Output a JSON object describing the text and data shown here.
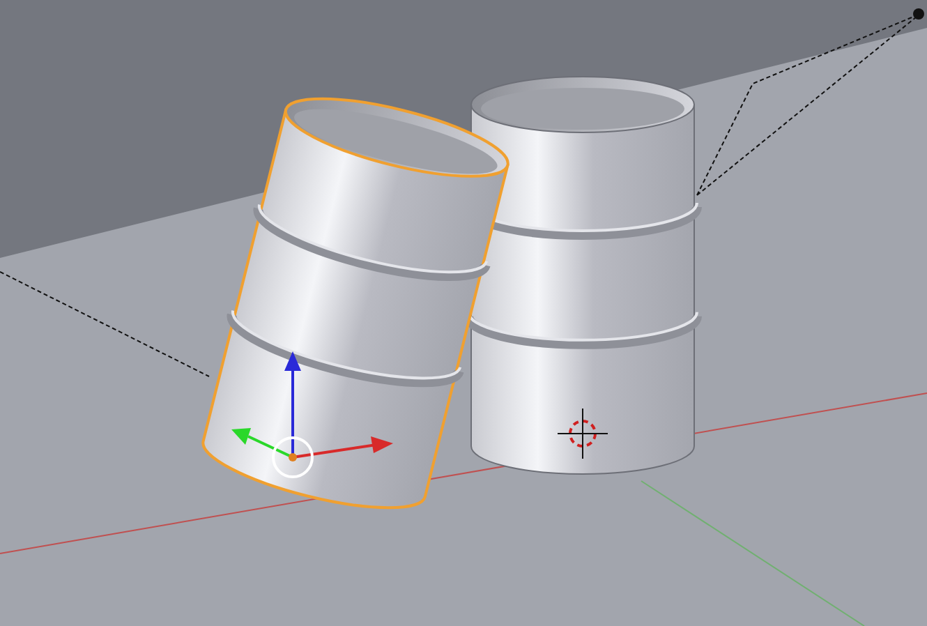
{
  "viewport": {
    "objects": [
      {
        "kind": "barrel",
        "selected": false
      },
      {
        "kind": "barrel",
        "selected": true
      }
    ]
  }
}
